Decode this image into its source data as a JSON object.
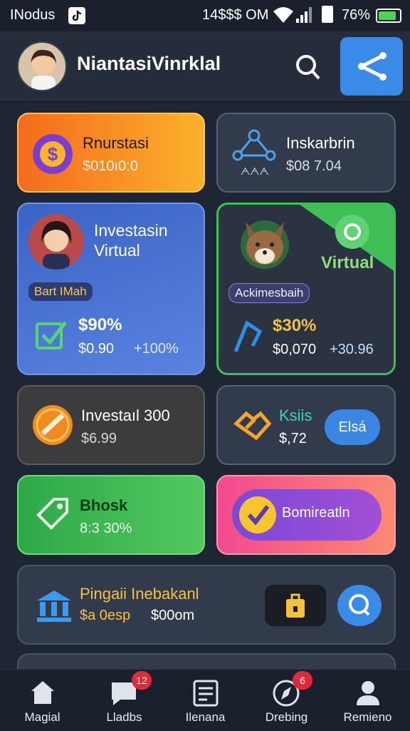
{
  "status_bar": {
    "carrier": "INodus",
    "center_text": "14$$$ OM",
    "battery_percent": "76%",
    "icons": [
      "tiktok-icon",
      "wifi-icon",
      "signal-icon",
      "sim-icon",
      "battery-icon"
    ]
  },
  "header": {
    "title": "NiantasiVinrklal",
    "search_icon": "search-icon",
    "share_icon": "share-icon"
  },
  "cards": {
    "c1": {
      "title": "Rnurstasi",
      "value": "$010ı0:0",
      "icon": "dollar-coin-icon"
    },
    "c2": {
      "title": "Inskarbrin",
      "value": "$08 7.04",
      "icon": "network-icon",
      "icon_caption": "ᗅᗅᗅ"
    },
    "c3": {
      "title_line1": "Investasin",
      "title_line2": "Virtual",
      "tag": "Bart IMah",
      "percent": "$90%",
      "value": "$0.90",
      "change": "+100%",
      "icon": "check-icon"
    },
    "c4": {
      "label": "Virtual",
      "tag": "Ackimesbaih",
      "percent": "$30%",
      "value": "$0,070",
      "change": "+30.96",
      "icons": [
        "fox-icon",
        "gear-icon",
        "trend-icon"
      ]
    },
    "c5": {
      "title": "Investaıl 300",
      "value": "$6.99",
      "icon": "coin-icon"
    },
    "c6": {
      "title": "Ksiis",
      "value": "$,72",
      "button": "Elsá",
      "icon": "handshake-icon"
    },
    "c7": {
      "title": "Bhosk",
      "value": "8:3 30%",
      "icon": "tag-icon"
    },
    "c8": {
      "button": "Bomireatln",
      "icon": "check-badge-icon"
    },
    "c9": {
      "title": "Pingaii Inebakanl",
      "value_left": "$a 0esp",
      "value_right": "$00om",
      "icon": "bank-icon"
    }
  },
  "nav": {
    "items": [
      {
        "label": "Magial",
        "icon": "home-icon"
      },
      {
        "label": "Lladbs",
        "icon": "chat-icon",
        "badge": "12"
      },
      {
        "label": "Ilenana",
        "icon": "document-icon"
      },
      {
        "label": "Drebing",
        "icon": "compass-icon",
        "badge": "6"
      },
      {
        "label": "Remieno",
        "icon": "user-icon"
      }
    ]
  },
  "colors": {
    "background": "#1f2633",
    "orange": "#f7922a",
    "blue": "#4b74d6",
    "green": "#38b44e",
    "pink": "#f25aa0",
    "accent_blue": "#3a8ae8"
  }
}
